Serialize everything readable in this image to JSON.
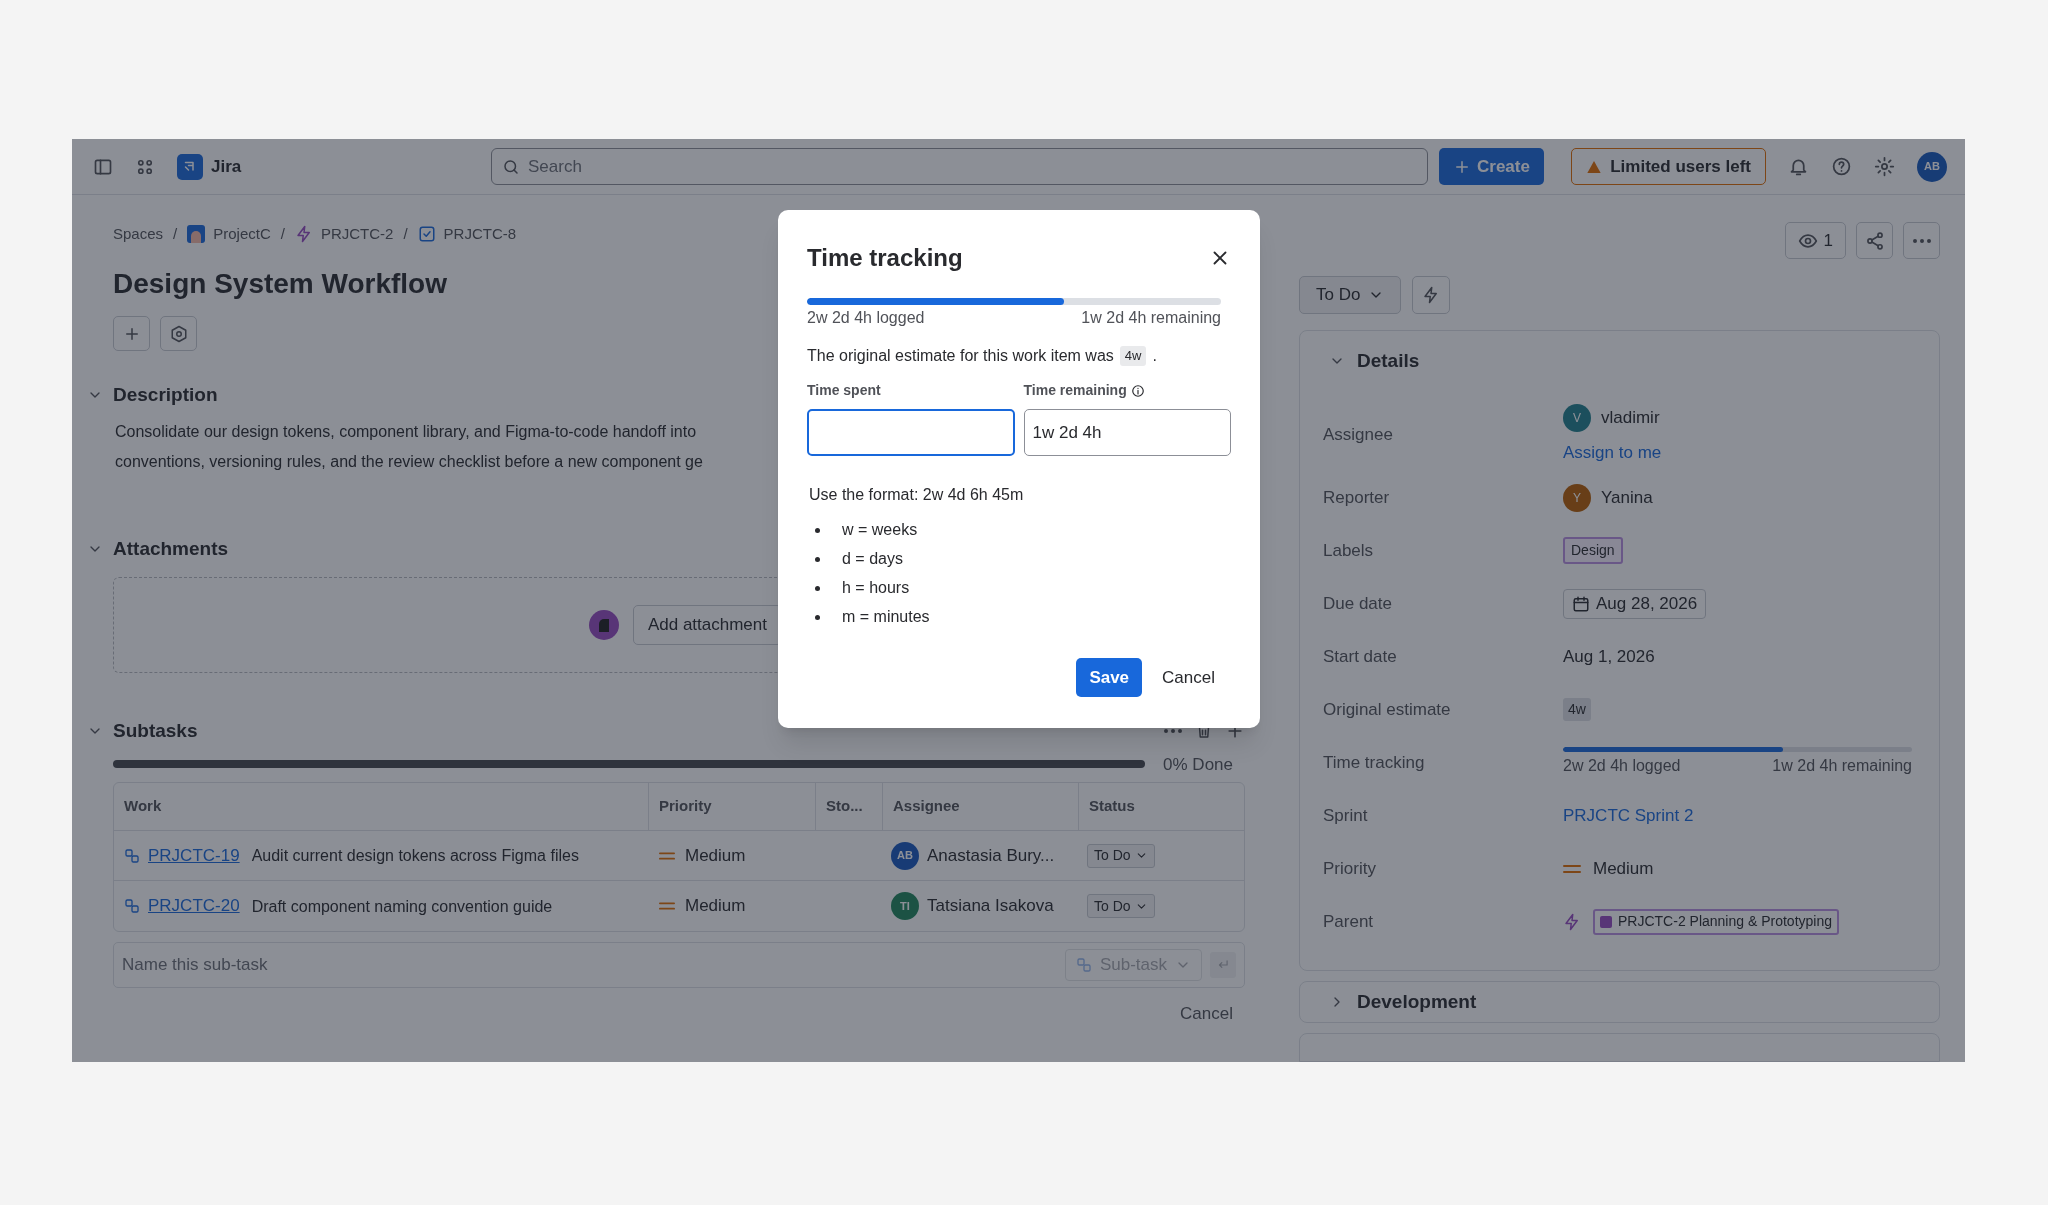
{
  "top_bar": {
    "product": "Jira",
    "search": {
      "placeholder": "Search"
    },
    "create_button": "Create",
    "limited_users_button": "Limited users left",
    "avatar": "AB"
  },
  "breadcrumbs": [
    {
      "label": "Spaces",
      "kind": "text",
      "separator": "/"
    },
    {
      "label": "ProjectC",
      "kind": "project",
      "separator": "/"
    },
    {
      "label": "PRJCTC-2",
      "kind": "epic",
      "separator": "/"
    },
    {
      "label": "PRJCTC-8",
      "kind": "task"
    }
  ],
  "title": "Design System Workflow",
  "description": {
    "heading": "Description",
    "expanded": true,
    "lines": [
      "Consolidate our design tokens, component library, and Figma-to-code handoff into",
      "conventions, versioning rules, and the review checklist before a new component ge"
    ]
  },
  "attachments": {
    "heading": "Attachments",
    "expanded": true,
    "button": "Add attachment"
  },
  "subtasks": {
    "heading": "Subtasks",
    "expanded": true,
    "progress": {
      "level": 0,
      "label": "0% Done"
    },
    "columns": [
      "Work",
      "Priority",
      "Sto...",
      "Assignee",
      "Status"
    ],
    "rows": [
      {
        "key": "PRJCTC-19",
        "summary": "Audit current design tokens across Figma files",
        "priority": "Medium",
        "assignee": {
          "initials": "AB",
          "name": "Anastasia Bury...",
          "color": "#183b75"
        },
        "status": "To Do"
      },
      {
        "key": "PRJCTC-20",
        "summary": "Draft component naming convention guide",
        "priority": "Medium",
        "assignee": {
          "initials": "TI",
          "name": "Tatsiana Isakova",
          "color": "#1c5244"
        },
        "status": "To Do"
      }
    ],
    "new_subtask": {
      "placeholder": "Name this sub-task",
      "type_button": "Sub-task"
    },
    "cancel": "Cancel"
  },
  "watchers": {
    "count": "1"
  },
  "status_button": "To Do",
  "details": {
    "heading": "Details",
    "expanded": true,
    "fields": [
      {
        "label": "Assignee",
        "kind": "user",
        "value": "vladimir",
        "initial": "V",
        "color": "#1c4f5d",
        "link": "Assign to me"
      },
      {
        "label": "Reporter",
        "kind": "user",
        "value": "Yanina",
        "initial": "Y",
        "color": "#683e18"
      },
      {
        "label": "Labels",
        "kind": "tag",
        "value": "Design"
      },
      {
        "label": "Due date",
        "kind": "date",
        "value": "Aug 28, 2026"
      },
      {
        "label": "Start date",
        "kind": "text",
        "value": "Aug 1, 2026"
      },
      {
        "label": "Original estimate",
        "kind": "chip",
        "value": "4w"
      },
      {
        "label": "Time tracking",
        "kind": "meter",
        "level": 0.63,
        "logged": "2w 2d 4h logged",
        "remaining": "1w 2d 4h remaining"
      },
      {
        "label": "Sprint",
        "kind": "link",
        "value": "PRJCTC Sprint 2"
      },
      {
        "label": "Priority",
        "kind": "priority",
        "value": "Medium"
      },
      {
        "label": "Parent",
        "kind": "parent",
        "value": "PRJCTC-2 Planning & Prototyping"
      }
    ]
  },
  "development": {
    "heading": "Development",
    "expanded": false
  },
  "modal": {
    "title": "Time tracking",
    "level": 0.62,
    "logged": "2w 2d 4h logged",
    "remaining": "1w 2d 4h remaining",
    "estimate_text": "The original estimate for this work item was",
    "estimate": "4w",
    "estimate_end": ".",
    "fields": [
      {
        "label": "Time spent",
        "focused": true,
        "info": false
      },
      {
        "label": "Time remaining",
        "value": "1w 2d 4h",
        "focused": false,
        "info": true
      }
    ],
    "format_hint": "Use the format: 2w 4d 6h 45m",
    "units": [
      "w = weeks",
      "d = days",
      "h = hours",
      "m = minutes"
    ],
    "save": "Save",
    "cancel": "Cancel"
  }
}
